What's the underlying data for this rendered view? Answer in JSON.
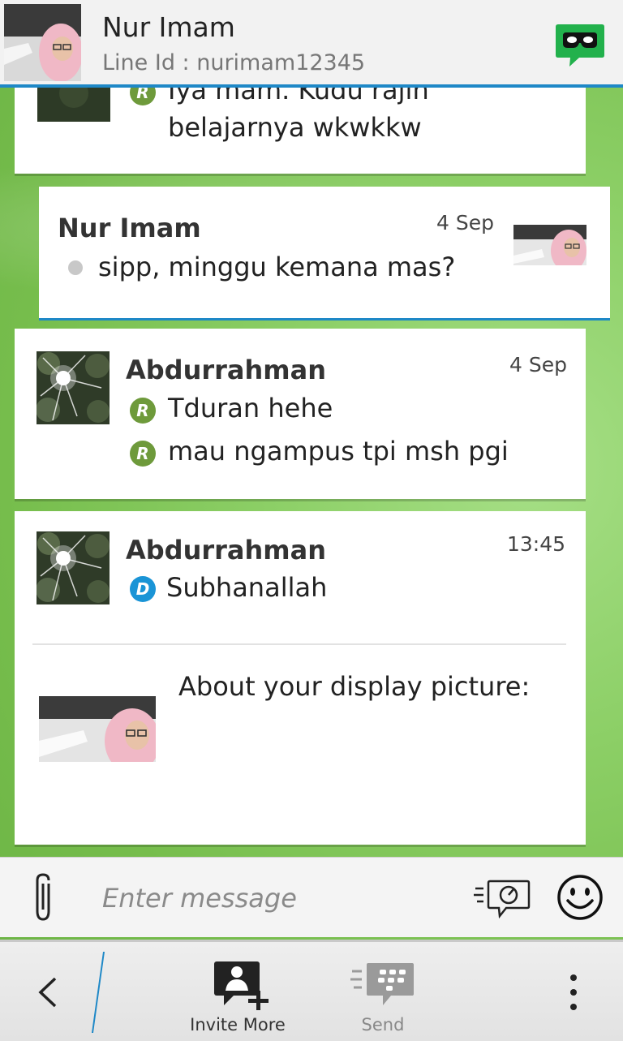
{
  "header": {
    "contact_name": "Nur Imam",
    "line_id": "Line Id : nurimam12345",
    "privacy_icon": "masked-chat-icon"
  },
  "messages": [
    {
      "sender": "",
      "time": "",
      "lines": [
        {
          "status": "R",
          "text": "Iya mam. Kudu rajin"
        },
        {
          "status": "",
          "text": "belajarnya wkwkkw"
        }
      ]
    },
    {
      "sender": "Nur Imam",
      "time": "4 Sep",
      "lines": [
        {
          "status": "dot",
          "text": "sipp, minggu kemana mas?"
        }
      ]
    },
    {
      "sender": "Abdurrahman",
      "time": "4 Sep",
      "lines": [
        {
          "status": "R",
          "text": "Tduran hehe"
        },
        {
          "status": "R",
          "text": "mau ngampus tpi msh pgi"
        }
      ]
    },
    {
      "sender": "Abdurrahman",
      "time": "13:45",
      "lines": [
        {
          "status": "D",
          "text": "Subhanallah"
        }
      ],
      "attachment_caption": "About your display picture:"
    }
  ],
  "composer": {
    "placeholder": "Enter message",
    "attach_icon": "paperclip-icon",
    "ping_icon": "ping-icon",
    "emoji_icon": "smiley-icon"
  },
  "actionbar": {
    "back_icon": "chevron-left-icon",
    "invite_label": "Invite More",
    "send_label": "Send",
    "overflow_icon": "more-vertical-icon"
  },
  "colors": {
    "accent": "#1e88c7",
    "read_badge": "#6e9a3b",
    "delivered_badge": "#1a94d6",
    "privacy_green": "#22b14c"
  }
}
